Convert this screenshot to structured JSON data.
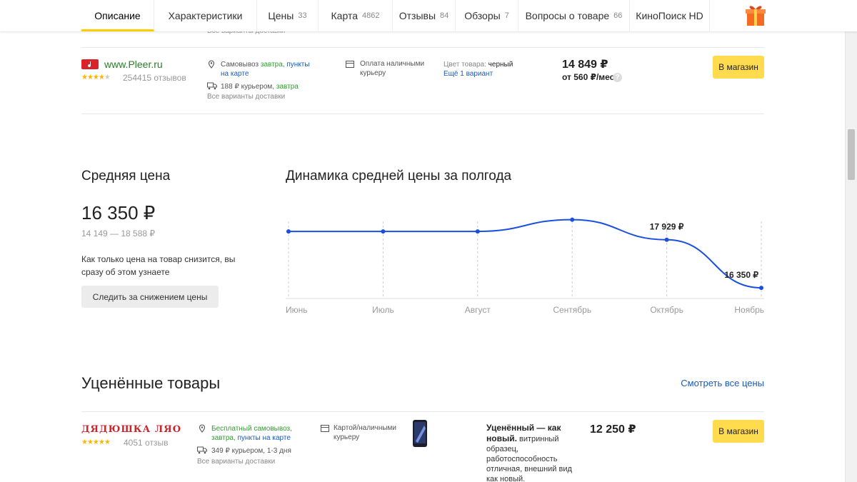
{
  "tabs": [
    {
      "label": "Описание",
      "count": "",
      "active": true
    },
    {
      "label": "Характеристики",
      "count": ""
    },
    {
      "label": "Цены",
      "count": "33"
    },
    {
      "label": "Карта",
      "count": "4862"
    },
    {
      "label": "Отзывы",
      "count": "84"
    },
    {
      "label": "Обзоры",
      "count": "7"
    },
    {
      "label": "Вопросы о товаре",
      "count": "66"
    },
    {
      "label": "КиноПоиск HD",
      "count": ""
    }
  ],
  "peek_text": "Все варианты доставки",
  "offer1": {
    "shop_name": "www.Pleer.ru",
    "rating": 4,
    "reviews": "254415 отзывов",
    "pickup_prefix": "Самовывоз",
    "pickup_when": "завтра",
    "pickup_points": "пункты на карте",
    "courier_price": "188 ₽ курьером,",
    "courier_when": "завтра",
    "all_delivery": "Все варианты доставки",
    "payment": "Оплата наличными курьеру",
    "color_label": "Цвет товара:",
    "color_value": "черный",
    "variant_link": "Ещё 1 вариант",
    "price": "14 849 ₽",
    "installment": "от 560 ₽/мес",
    "button": "В магазин"
  },
  "avg": {
    "title": "Средняя цена",
    "price": "16 350 ₽",
    "range": "14 149 — 18 588 ₽",
    "text": "Как только цена на товар снизится, вы сразу об этом узнаете",
    "follow_button": "Следить за снижением цены"
  },
  "chart_title": "Динамика средней цены за полгода",
  "chart_data": {
    "type": "line",
    "title": "Динамика средней цены за полгода",
    "categories": [
      "Июнь",
      "Июль",
      "Август",
      "Сентябрь",
      "Октябрь",
      "Ноябрь"
    ],
    "series": [
      {
        "values": [
          18200,
          18200,
          18200,
          18588,
          17929,
          16350
        ]
      }
    ],
    "labels": [
      {
        "index": 4,
        "text": "17 929 ₽"
      },
      {
        "index": 5,
        "text": "16 350 ₽"
      }
    ],
    "ylim": [
      16000,
      19000
    ],
    "grid": "vertical dashed",
    "color": "#1a4fe0"
  },
  "discounted": {
    "title": "Уценённые товары",
    "see_all": "Смотреть все цены",
    "shop_name": "ДЯДЮШКА ЛЯО",
    "rating": 5,
    "reviews": "4051 отзыв",
    "pickup_free": "Бесплатный самовывоз,",
    "pickup_when": "завтра,",
    "pickup_points": "пункты на карте",
    "courier": "349 ₽ курьером, 1-3 дня",
    "all_delivery": "Все варианты доставки",
    "payment": "Картой/наличными курьеру",
    "condition_bold": "Уценённый — как новый.",
    "condition_text": "витринный образец, работоспособность отличная, внешний вид как новый.",
    "price": "12 250 ₽",
    "button": "В магазин"
  },
  "colors": {
    "accent": "#ffdb4d",
    "link": "#1a5ab8",
    "green": "#2d9f2d",
    "chart": "#1a4fe0"
  }
}
